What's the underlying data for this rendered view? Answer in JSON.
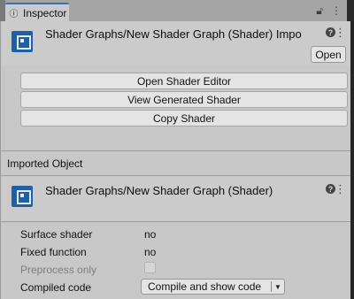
{
  "tab": {
    "label": "Inspector"
  },
  "importer": {
    "title": "Shader Graphs/New Shader Graph (Shader) Impo",
    "open_label": "Open"
  },
  "actions": {
    "open_editor": "Open Shader Editor",
    "view_generated": "View Generated Shader",
    "copy_shader": "Copy Shader"
  },
  "imported_section": {
    "label": "Imported Object"
  },
  "object": {
    "title": "Shader Graphs/New Shader Graph (Shader)"
  },
  "properties": [
    {
      "label": "Surface shader",
      "value": "no"
    },
    {
      "label": "Fixed function",
      "value": "no"
    },
    {
      "label": "Preprocess only",
      "checked": false,
      "disabled": true
    },
    {
      "label": "Compiled code",
      "dropdown": "Compile and show code"
    }
  ],
  "colors": {
    "accent": "#3a72b0",
    "panel": "#c8c8c8",
    "asset_icon": "#1f5fa5"
  },
  "icons": [
    "inspector-icon",
    "lock-icon",
    "kebab-menu-icon",
    "help-icon",
    "shader-asset-icon",
    "dropdown-arrow-icon"
  ]
}
